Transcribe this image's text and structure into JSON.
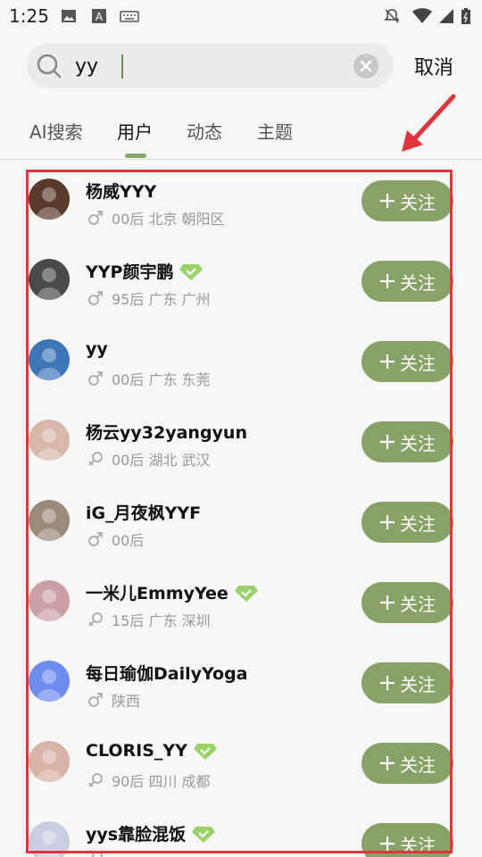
{
  "status_bar": {
    "time": "1:25"
  },
  "search": {
    "value": "yy",
    "cancel_label": "取消"
  },
  "tabs": [
    {
      "label": "AI搜索",
      "active": false
    },
    {
      "label": "用户",
      "active": true
    },
    {
      "label": "动态",
      "active": false
    },
    {
      "label": "主题",
      "active": false
    }
  ],
  "users": [
    {
      "name": "杨威YYY",
      "meta": "00后 北京 朝阳区",
      "gender": "male",
      "verified": false,
      "avatar_color": "#5a3a2a",
      "follow_label": "关注"
    },
    {
      "name": "YYP颜宇鹏",
      "meta": "95后 广东 广州",
      "gender": "male",
      "verified": true,
      "avatar_color": "#4a4a4a",
      "follow_label": "关注"
    },
    {
      "name": "yy",
      "meta": "00后 广东 东莞",
      "gender": "male",
      "verified": false,
      "avatar_color": "#3f76b8",
      "follow_label": "关注"
    },
    {
      "name": "杨云yy32yangyun",
      "meta": "00后 湖北 武汉",
      "gender": "female",
      "verified": false,
      "avatar_color": "#d8b7a8",
      "follow_label": "关注"
    },
    {
      "name": "iG_月夜枫YYF",
      "meta": "00后",
      "gender": "male",
      "verified": false,
      "avatar_color": "#9a8a7a",
      "follow_label": "关注"
    },
    {
      "name": "一米儿EmmyYee",
      "meta": "15后 广东 深圳",
      "gender": "female",
      "verified": true,
      "avatar_color": "#caa0a6",
      "follow_label": "关注"
    },
    {
      "name": "每日瑜伽DailyYoga",
      "meta": "陕西",
      "gender": "male",
      "verified": false,
      "avatar_color": "#6d8cf0",
      "follow_label": "关注"
    },
    {
      "name": "CLORIS_YY",
      "meta": "90后 四川 成都",
      "gender": "female",
      "verified": true,
      "avatar_color": "#d9b2a8",
      "follow_label": "关注"
    },
    {
      "name": "yys靠脸混饭",
      "meta": "",
      "gender": "female",
      "verified": true,
      "avatar_color": "#c9cfe0",
      "follow_label": "关注"
    }
  ],
  "colors": {
    "accent": "#86a266",
    "highlight": "#e0353a",
    "verified": "#9bd36a"
  }
}
